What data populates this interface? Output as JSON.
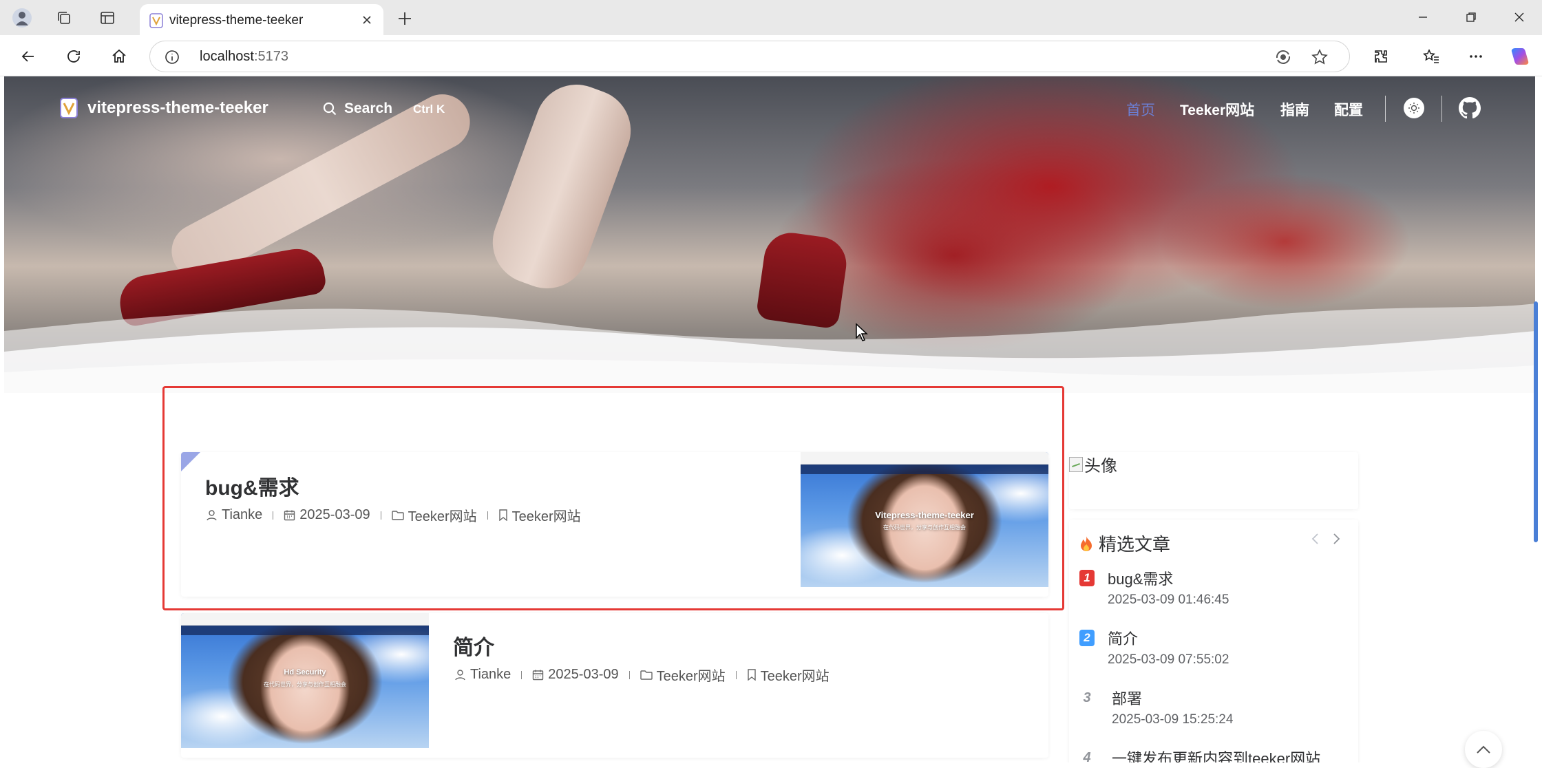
{
  "browser": {
    "tab_title": "vitepress-theme-teeker",
    "address_host": "localhost",
    "address_port": ":5173"
  },
  "site": {
    "title": "vitepress-theme-teeker",
    "search_label": "Search",
    "search_shortcut": "Ctrl K",
    "nav": [
      {
        "label": "首页",
        "active": true
      },
      {
        "label": "Teeker网站",
        "active": false
      },
      {
        "label": "指南",
        "active": false
      },
      {
        "label": "配置",
        "active": false
      }
    ]
  },
  "posts": [
    {
      "title": "bug&需求",
      "author": "Tianke",
      "date": "2025-03-09",
      "category": "Teeker网站",
      "tag": "Teeker网站",
      "thumb_caption": "Vitepress-theme-teeker",
      "thumb_subcaption": "在代码世界，分享与创作互相融会"
    },
    {
      "title": "简介",
      "author": "Tianke",
      "date": "2025-03-09",
      "category": "Teeker网站",
      "tag": "Teeker网站",
      "thumb_caption": "Hd Security",
      "thumb_subcaption": "在代码世界，分享与创作互相融会"
    }
  ],
  "sidebar": {
    "avatar_alt": "头像",
    "featured_title": "精选文章",
    "featured": [
      {
        "rank": "1",
        "title": "bug&需求",
        "date": "2025-03-09 01:46:45",
        "color": "#e53935"
      },
      {
        "rank": "2",
        "title": "简介",
        "date": "2025-03-09 07:55:02",
        "color": "#409eff"
      },
      {
        "rank": "3",
        "title": "部署",
        "date": "2025-03-09 15:25:24",
        "color": ""
      },
      {
        "rank": "4",
        "title": "一键发布更新内容到teeker网站",
        "date": "",
        "color": ""
      }
    ]
  },
  "colors": {
    "accent": "#6b7fd4",
    "highlight_border": "#e53935"
  }
}
